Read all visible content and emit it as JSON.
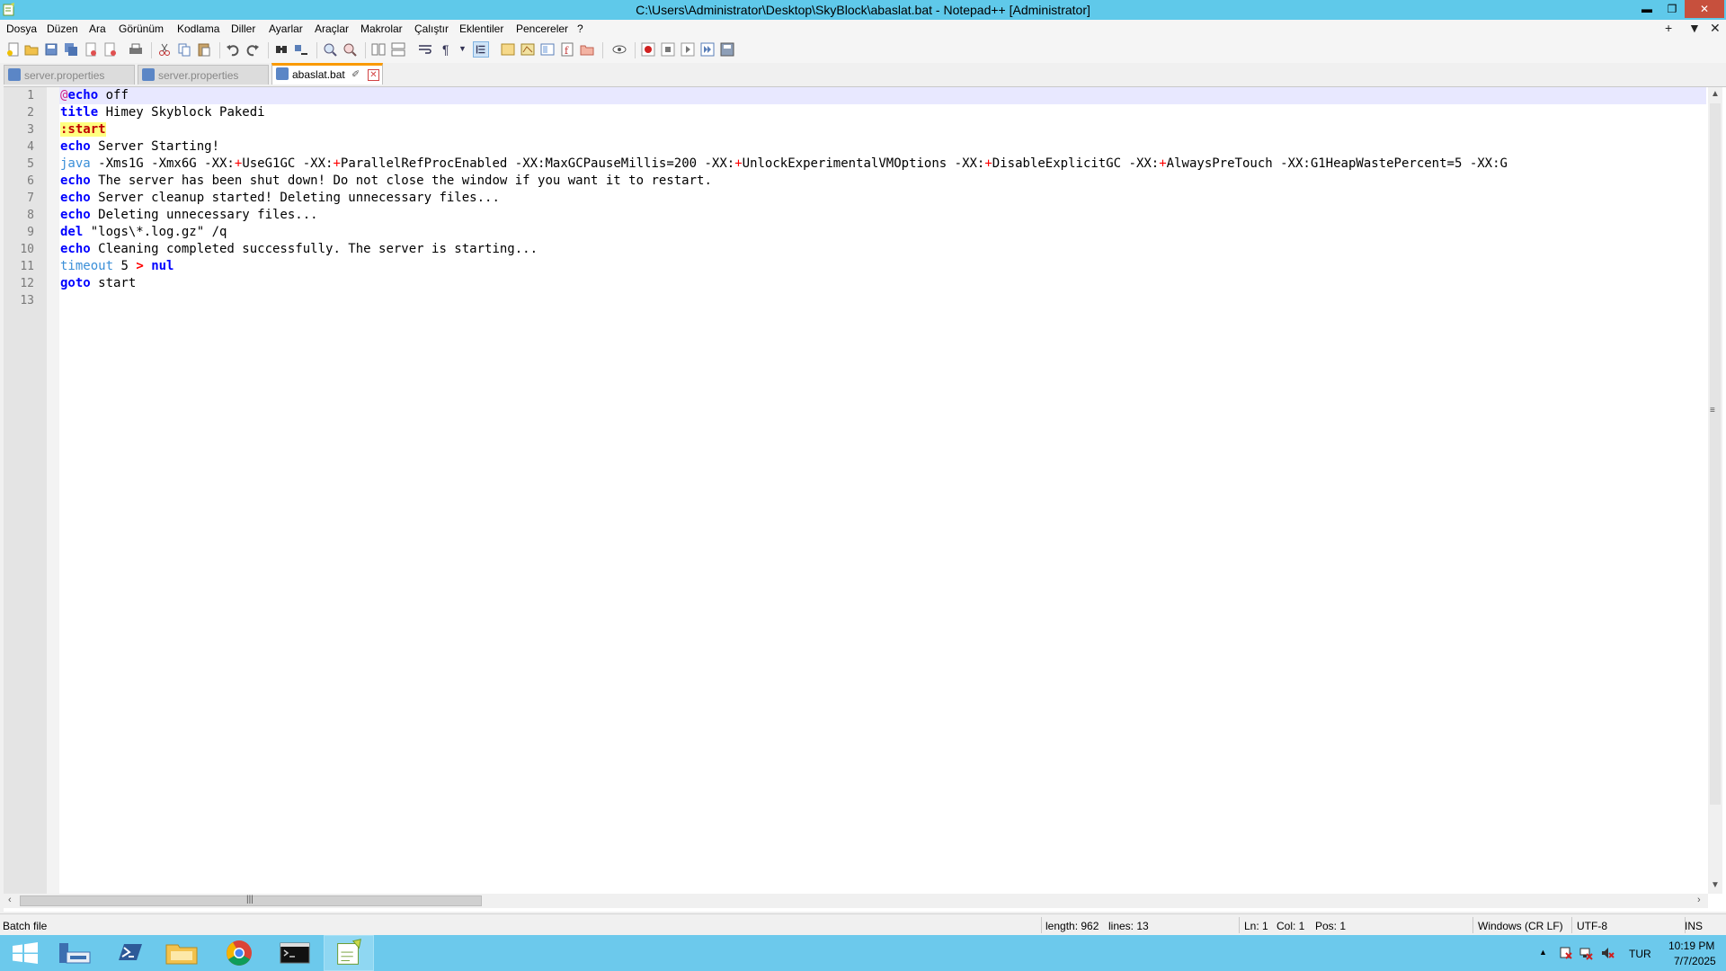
{
  "window": {
    "title": "C:\\Users\\Administrator\\Desktop\\SkyBlock\\abaslat.bat - Notepad++ [Administrator]",
    "minimize_glyph": "▬",
    "restore_glyph": "❐",
    "close_glyph": "✕"
  },
  "menu": {
    "items": [
      "Dosya",
      "Düzen",
      "Ara",
      "Görünüm",
      "Kodlama",
      "Diller",
      "Ayarlar",
      "Araçlar",
      "Makrolar",
      "Çalıştır",
      "Eklentiler",
      "Pencereler",
      "?"
    ],
    "right_controls": [
      "+",
      "▼",
      "✕"
    ]
  },
  "tabs": [
    {
      "label": "server.properties",
      "active": false
    },
    {
      "label": "server.properties",
      "active": false
    },
    {
      "label": "abaslat.bat",
      "active": true,
      "close_glyph": "✕"
    }
  ],
  "editor": {
    "line_numbers": [
      "1",
      "2",
      "3",
      "4",
      "5",
      "6",
      "7",
      "8",
      "9",
      "10",
      "11",
      "12",
      "13"
    ],
    "lines": [
      {
        "tokens": [
          {
            "t": "@",
            "c": "at"
          },
          {
            "t": "echo",
            "c": "kw"
          },
          {
            "t": " off",
            "c": "dim"
          }
        ]
      },
      {
        "tokens": [
          {
            "t": "title",
            "c": "kw"
          },
          {
            "t": " Himey Skyblock Pakedi",
            "c": "dim"
          }
        ]
      },
      {
        "tokens": [
          {
            "t": ":start",
            "c": "label-hl"
          }
        ]
      },
      {
        "tokens": [
          {
            "t": "echo",
            "c": "kw"
          },
          {
            "t": " Server Starting!",
            "c": "dim"
          }
        ]
      },
      {
        "tokens": [
          {
            "t": "java",
            "c": "kw2"
          },
          {
            "t": " -Xms1G -Xmx6G -XX:",
            "c": "dim"
          },
          {
            "t": "+",
            "c": "op"
          },
          {
            "t": "UseG1GC -XX:",
            "c": "dim"
          },
          {
            "t": "+",
            "c": "op"
          },
          {
            "t": "ParallelRefProcEnabled -XX:MaxGCPauseMillis=200 -XX:",
            "c": "dim"
          },
          {
            "t": "+",
            "c": "op"
          },
          {
            "t": "UnlockExperimentalVMOptions -XX:",
            "c": "dim"
          },
          {
            "t": "+",
            "c": "op"
          },
          {
            "t": "DisableExplicitGC -XX:",
            "c": "dim"
          },
          {
            "t": "+",
            "c": "op"
          },
          {
            "t": "AlwaysPreTouch -XX:G1HeapWastePercent=5 -XX:G",
            "c": "dim"
          }
        ]
      },
      {
        "tokens": [
          {
            "t": "echo",
            "c": "kw"
          },
          {
            "t": " The server has been shut down! Do not close the window if you want it to restart.",
            "c": "dim"
          }
        ]
      },
      {
        "tokens": [
          {
            "t": "echo",
            "c": "kw"
          },
          {
            "t": " Server cleanup started! Deleting unnecessary files...",
            "c": "dim"
          }
        ]
      },
      {
        "tokens": [
          {
            "t": "echo",
            "c": "kw"
          },
          {
            "t": " Deleting unnecessary files...",
            "c": "dim"
          }
        ]
      },
      {
        "tokens": [
          {
            "t": "del",
            "c": "kw"
          },
          {
            "t": " \"logs\\*.log.gz\" /q",
            "c": "dim"
          }
        ]
      },
      {
        "tokens": [
          {
            "t": "echo",
            "c": "kw"
          },
          {
            "t": " Cleaning completed successfully. The server is starting...",
            "c": "dim"
          }
        ]
      },
      {
        "tokens": [
          {
            "t": "timeout",
            "c": "kw2"
          },
          {
            "t": " 5 ",
            "c": "dim"
          },
          {
            "t": ">",
            "c": "opb"
          },
          {
            "t": " ",
            "c": "dim"
          },
          {
            "t": "nul",
            "c": "kw"
          }
        ]
      },
      {
        "tokens": [
          {
            "t": "goto",
            "c": "kw"
          },
          {
            "t": " start",
            "c": "dim"
          }
        ]
      },
      {
        "tokens": []
      }
    ]
  },
  "statusbar": {
    "language": "Batch file",
    "length": "length: 962",
    "lines": "lines: 13",
    "ln": "Ln: 1",
    "col": "Col: 1",
    "pos": "Pos: 1",
    "eol": "Windows (CR LF)",
    "encoding": "UTF-8",
    "mode": "INS"
  },
  "taskbar": {
    "apps": [
      "windows-start",
      "server-manager",
      "powershell",
      "file-explorer",
      "chrome",
      "command-prompt",
      "notepad-plus-plus"
    ],
    "active_app": "notepad-plus-plus",
    "tray": {
      "show_hidden_glyph": "▲",
      "language": "TUR",
      "time": "10:19 PM",
      "date": "7/7/2025"
    }
  },
  "colors": {
    "titlebar": "#5fc9ea",
    "taskbar": "#6cc9ec",
    "keyword": "#0000ff",
    "label_highlight": "#ffff80",
    "active_tab_accent": "#fa9a00"
  }
}
